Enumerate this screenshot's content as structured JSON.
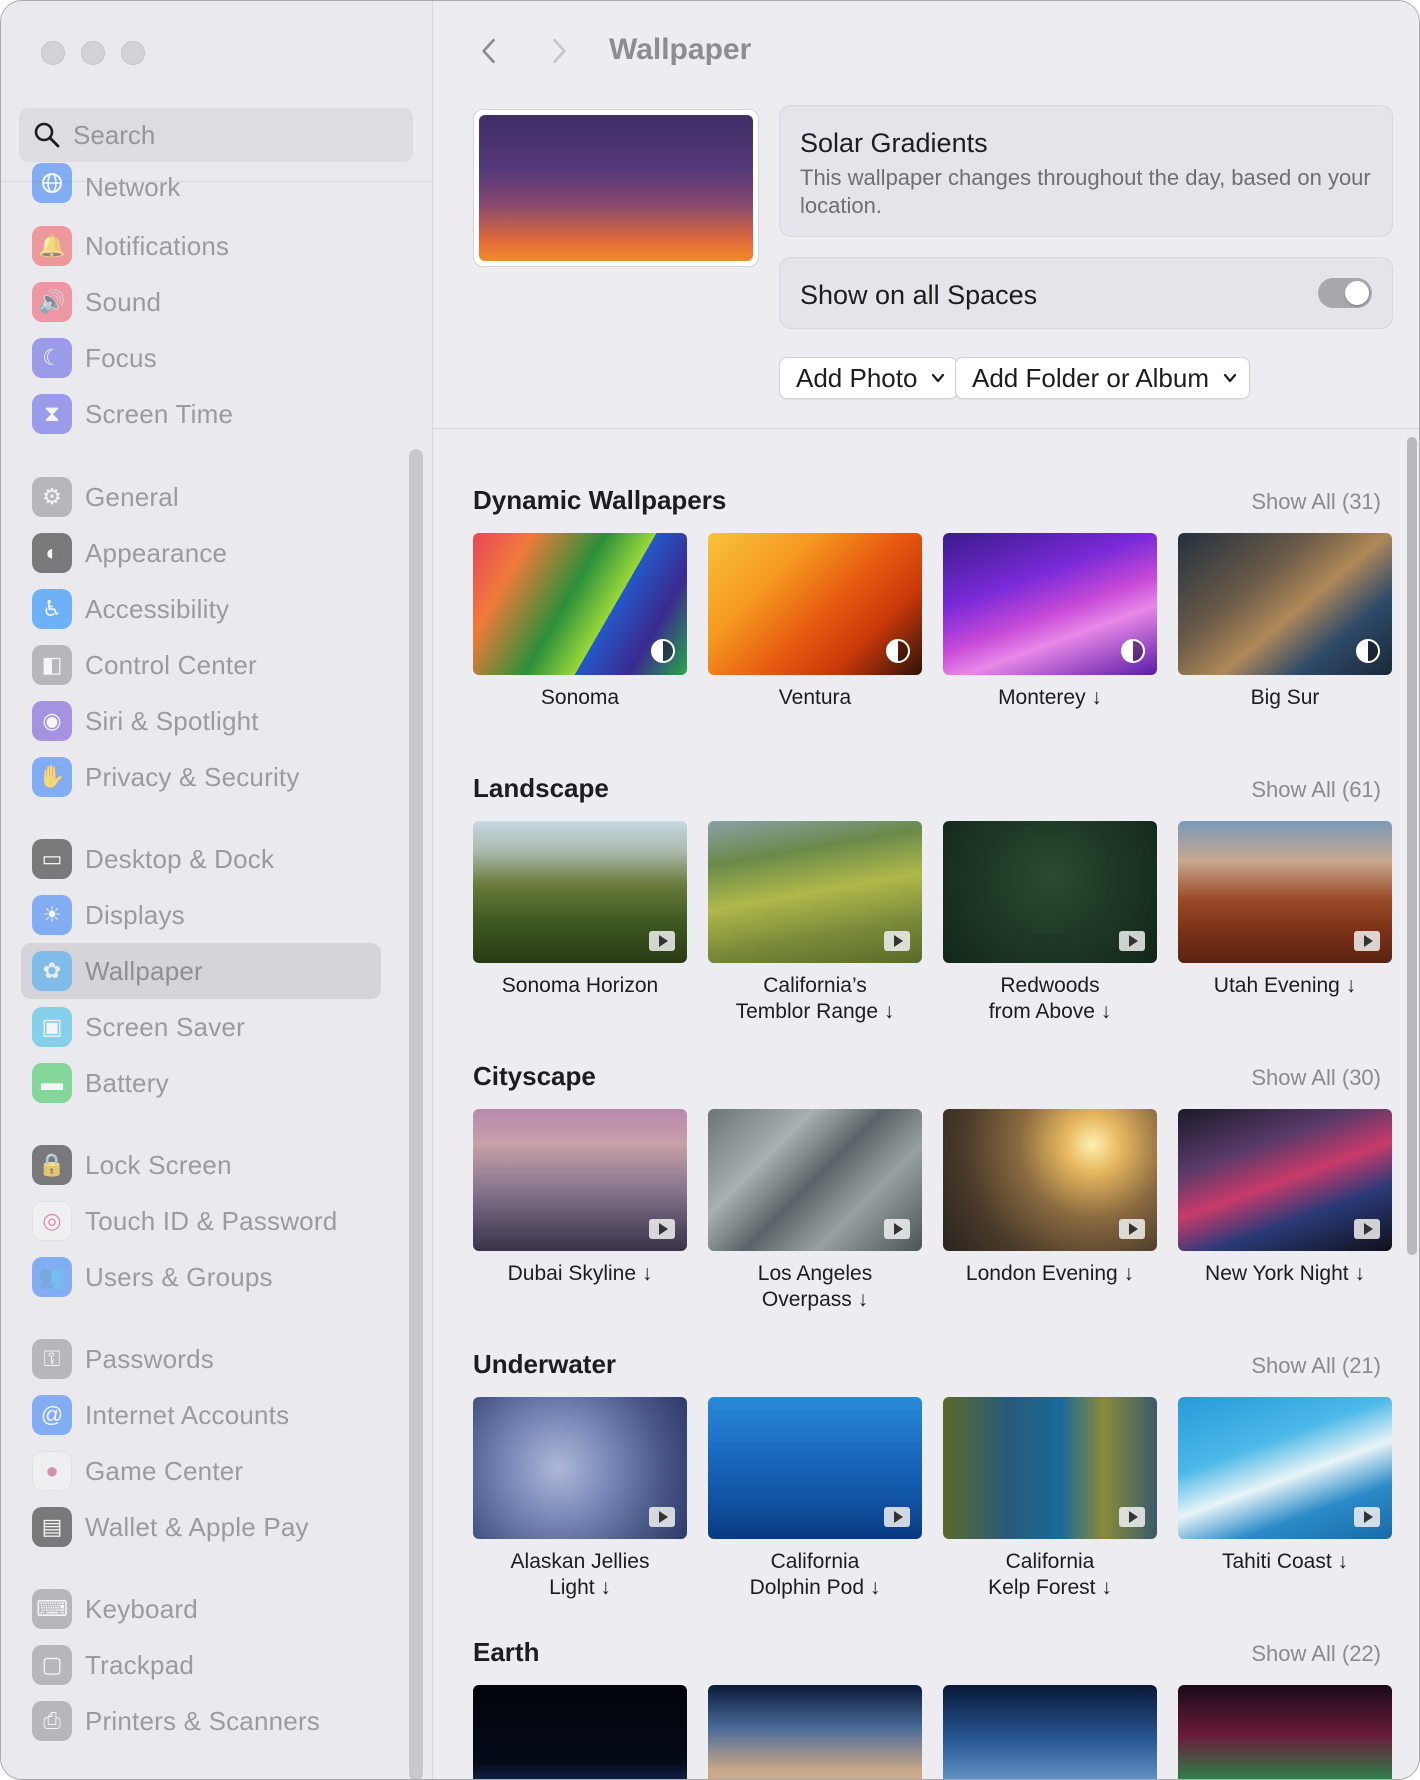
{
  "window": {
    "traffic_lights": [
      "close",
      "minimize",
      "zoom"
    ]
  },
  "search": {
    "placeholder": "Search"
  },
  "sidebar": {
    "partial_item": "Network",
    "items": [
      {
        "label": "Notifications",
        "icon": "bell-icon",
        "color": "#f0565b"
      },
      {
        "label": "Sound",
        "icon": "speaker-icon",
        "color": "#f05468"
      },
      {
        "label": "Focus",
        "icon": "moon-icon",
        "color": "#5e5ce6"
      },
      {
        "label": "Screen Time",
        "icon": "hourglass-icon",
        "color": "#5e5ce6"
      },
      {
        "label": "General",
        "icon": "gear-icon",
        "color": "#8e8e93"
      },
      {
        "label": "Appearance",
        "icon": "appearance-icon",
        "color": "#1d1d1f"
      },
      {
        "label": "Accessibility",
        "icon": "accessibility-icon",
        "color": "#0a84ff"
      },
      {
        "label": "Control Center",
        "icon": "toggles-icon",
        "color": "#8e8e93"
      },
      {
        "label": "Siri & Spotlight",
        "icon": "siri-icon",
        "color": "#6e4bd8"
      },
      {
        "label": "Privacy & Security",
        "icon": "hand-icon",
        "color": "#2f7cf6"
      },
      {
        "label": "Desktop & Dock",
        "icon": "dock-icon",
        "color": "#1d1d1f"
      },
      {
        "label": "Displays",
        "icon": "sun-icon",
        "color": "#2f7cf6"
      },
      {
        "label": "Wallpaper",
        "icon": "flower-icon",
        "color": "#3fa8f5",
        "selected": true
      },
      {
        "label": "Screen Saver",
        "icon": "screensaver-icon",
        "color": "#35b9e6"
      },
      {
        "label": "Battery",
        "icon": "battery-icon",
        "color": "#34c759"
      },
      {
        "label": "Lock Screen",
        "icon": "lock-icon",
        "color": "#1d1d1f"
      },
      {
        "label": "Touch ID & Password",
        "icon": "fingerprint-icon",
        "color": "#f4f4f6"
      },
      {
        "label": "Users & Groups",
        "icon": "users-icon",
        "color": "#2f7cf6"
      },
      {
        "label": "Passwords",
        "icon": "key-icon",
        "color": "#8e8e93"
      },
      {
        "label": "Internet Accounts",
        "icon": "at-icon",
        "color": "#2f7cf6"
      },
      {
        "label": "Game Center",
        "icon": "gamecenter-icon",
        "color": "#f4f4f6"
      },
      {
        "label": "Wallet & Apple Pay",
        "icon": "wallet-icon",
        "color": "#1d1d1f"
      },
      {
        "label": "Keyboard",
        "icon": "keyboard-icon",
        "color": "#8e8e93"
      },
      {
        "label": "Trackpad",
        "icon": "trackpad-icon",
        "color": "#8e8e93"
      },
      {
        "label": "Printers & Scanners",
        "icon": "printer-icon",
        "color": "#8e8e93"
      }
    ]
  },
  "main": {
    "title": "Wallpaper",
    "current": {
      "name": "Solar Gradients",
      "description": "This wallpaper changes throughout the day, based on your location."
    },
    "show_on_all_spaces": {
      "label": "Show on all Spaces",
      "on": false
    },
    "add_photo": "Add Photo",
    "add_folder": "Add Folder or Album",
    "sections": [
      {
        "title": "Dynamic Wallpapers",
        "show_all": "Show All (31)",
        "badge": "dynamic",
        "items": [
          {
            "name": "Sonoma"
          },
          {
            "name": "Ventura"
          },
          {
            "name": "Monterey ↓"
          },
          {
            "name": "Big Sur"
          }
        ]
      },
      {
        "title": "Landscape",
        "show_all": "Show All (61)",
        "badge": "video",
        "items": [
          {
            "name": "Sonoma Horizon"
          },
          {
            "name": "California’s\nTemblor Range ↓"
          },
          {
            "name": "Redwoods\nfrom Above ↓"
          },
          {
            "name": "Utah Evening ↓"
          }
        ]
      },
      {
        "title": "Cityscape",
        "show_all": "Show All (30)",
        "badge": "video",
        "items": [
          {
            "name": "Dubai Skyline ↓"
          },
          {
            "name": "Los Angeles\nOverpass ↓"
          },
          {
            "name": "London Evening ↓"
          },
          {
            "name": "New York Night ↓"
          }
        ]
      },
      {
        "title": "Underwater",
        "show_all": "Show All (21)",
        "badge": "video",
        "items": [
          {
            "name": "Alaskan Jellies\nLight ↓"
          },
          {
            "name": "California\nDolphin Pod ↓"
          },
          {
            "name": "California\nKelp Forest ↓"
          },
          {
            "name": "Tahiti Coast ↓"
          }
        ]
      },
      {
        "title": "Earth",
        "show_all": "Show All (22)",
        "badge": "video",
        "items": [
          {
            "name": ""
          },
          {
            "name": ""
          },
          {
            "name": ""
          },
          {
            "name": ""
          }
        ]
      }
    ]
  }
}
